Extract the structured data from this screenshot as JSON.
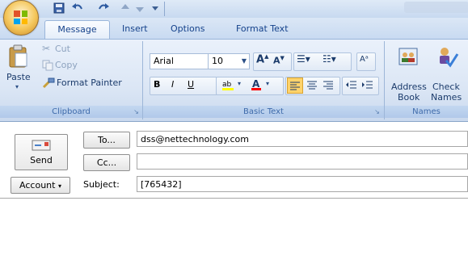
{
  "quick_access": {
    "items": [
      "save-icon",
      "undo-icon",
      "redo-icon",
      "arrow-up-icon",
      "arrow-down-icon",
      "customize-qat-icon"
    ]
  },
  "tabs": [
    {
      "label": "Message",
      "active": true
    },
    {
      "label": "Insert"
    },
    {
      "label": "Options"
    },
    {
      "label": "Format Text"
    }
  ],
  "clipboard": {
    "paste_label": "Paste",
    "cut_label": "Cut",
    "copy_label": "Copy",
    "format_painter_label": "Format Painter",
    "group_label": "Clipboard"
  },
  "basic_text": {
    "font_name": "Arial",
    "font_size": "10",
    "group_label": "Basic Text",
    "highlight_color": "#ffff00",
    "font_color": "#ff0000"
  },
  "names": {
    "address_book_line1": "Address",
    "address_book_line2": "Book",
    "check_names_line1": "Check",
    "check_names_line2": "Names",
    "group_label": "Names"
  },
  "compose": {
    "send_label": "Send",
    "to_label": "To...",
    "cc_label": "Cc...",
    "account_label": "Account",
    "subject_label": "Subject:",
    "to_value": "dss@nettechnology.com",
    "cc_value": "",
    "subject_value": "[765432]"
  },
  "colors": {
    "ribbon_accent": "#15428b",
    "group_label_bg": "#b1c9ea"
  }
}
